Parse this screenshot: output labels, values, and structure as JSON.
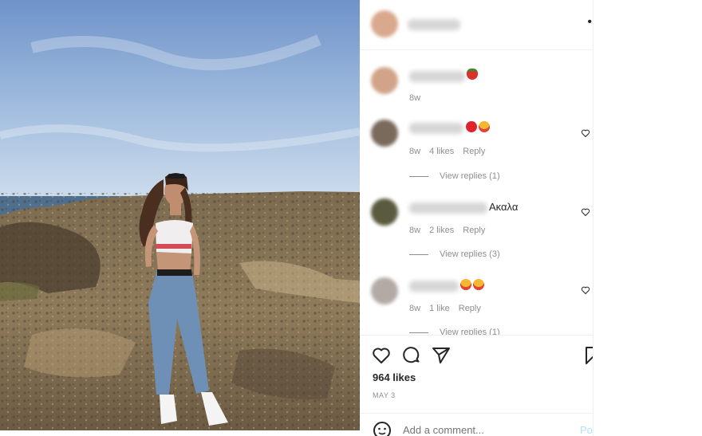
{
  "post": {
    "header": {
      "username": "",
      "more_icon": "more-dots-icon"
    },
    "comments": [
      {
        "emoji": [
          "strawberry"
        ],
        "time": "8w",
        "likes": "",
        "reply": "",
        "view_replies": ""
      },
      {
        "emoji": [
          "red-heart",
          "heart-eyes"
        ],
        "time": "8w",
        "likes": "4 likes",
        "reply": "Reply",
        "view_replies": "View replies (1)"
      },
      {
        "text": "Ακαλα",
        "time": "8w",
        "likes": "2 likes",
        "reply": "Reply",
        "view_replies": "View replies (3)"
      },
      {
        "emoji": [
          "heart-eyes",
          "heart-eyes"
        ],
        "time": "8w",
        "likes": "1 like",
        "reply": "Reply",
        "view_replies": "View replies (1)"
      }
    ],
    "likes_count": "964 likes",
    "date": "MAY 3",
    "add_comment_placeholder": "Add a comment...",
    "post_button": "Post"
  },
  "colors": {
    "text": "#262626",
    "muted": "#8e8e8e",
    "border": "#efefef",
    "post_blue": "#b2dffc"
  }
}
